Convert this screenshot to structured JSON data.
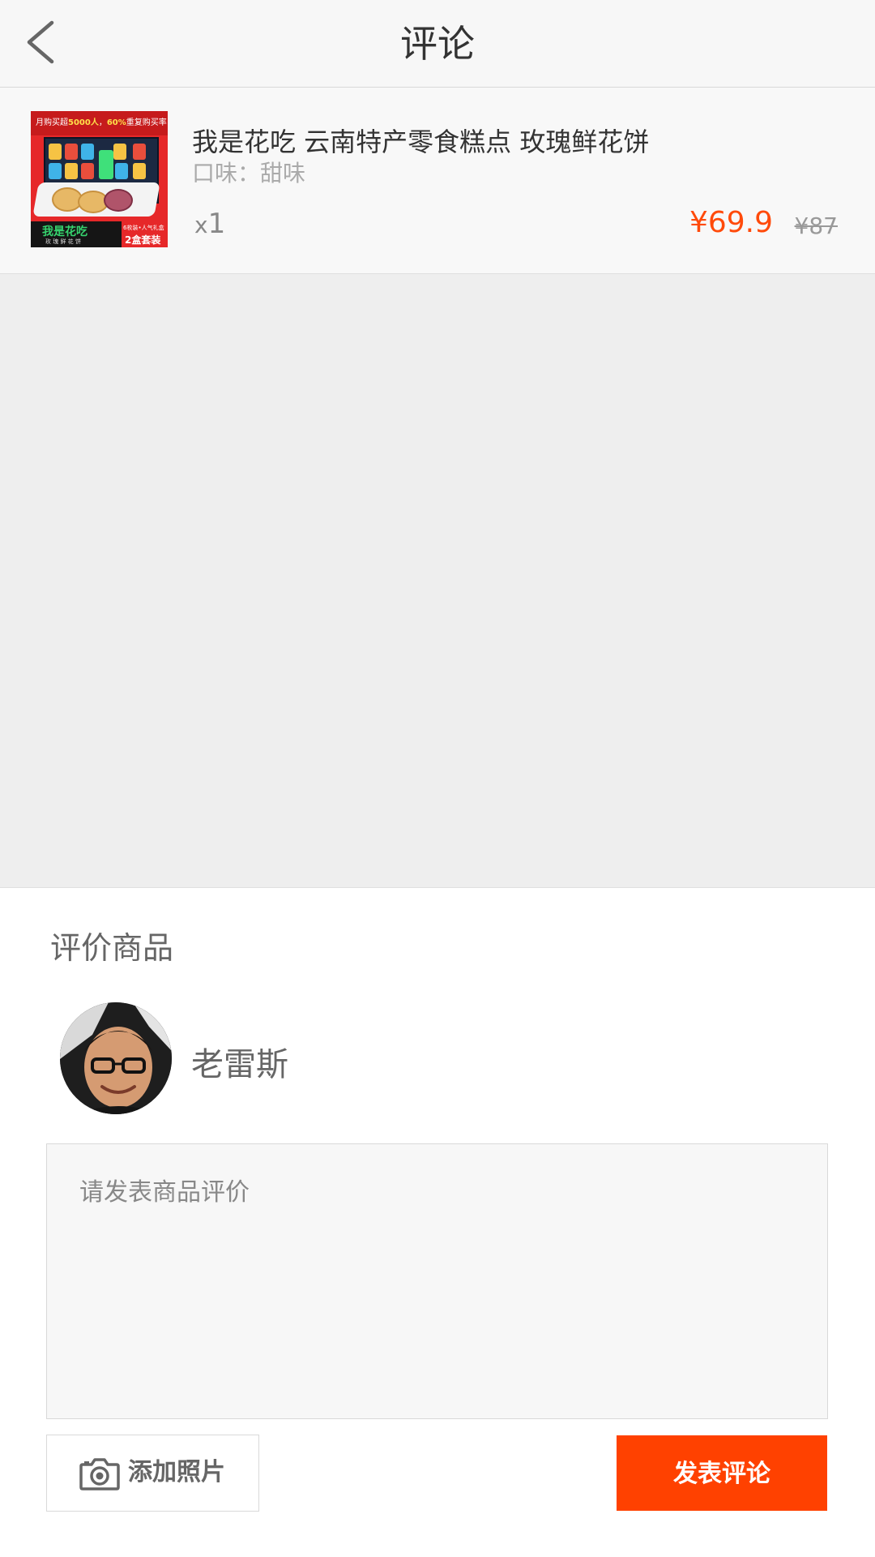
{
  "header": {
    "title": "评论"
  },
  "product": {
    "name": "我是花吃 云南特产零食糕点 玫瑰鲜花饼",
    "spec": "口味：甜味",
    "qty_prefix": "x",
    "qty_value": "1",
    "price_now": "¥69.9",
    "price_old": "¥87",
    "image": {
      "banner_prefix": "月购买超",
      "banner_highlight_1": "5000人",
      "banner_mid": "，",
      "banner_highlight_2": "60%",
      "banner_suffix": "重复购买率",
      "brand": "我是花吃",
      "brand_sub": "玫 瑰 鲜 花 饼",
      "tag_small": "6枚装•人气礼盒",
      "tag_big": "2盒套装"
    }
  },
  "review": {
    "section_title": "评价商品",
    "user_name": "老雷斯",
    "input_value": "",
    "input_placeholder": "请发表商品评价",
    "add_photo_label": "添加照片",
    "submit_label": "发表评论"
  },
  "colors": {
    "accent": "#ff4100",
    "price": "#ff4a0a",
    "header_bg": "#f7f7f7",
    "gray_area": "#eeeeee"
  },
  "icons": {
    "back": "chevron-left-icon",
    "camera": "camera-icon"
  }
}
